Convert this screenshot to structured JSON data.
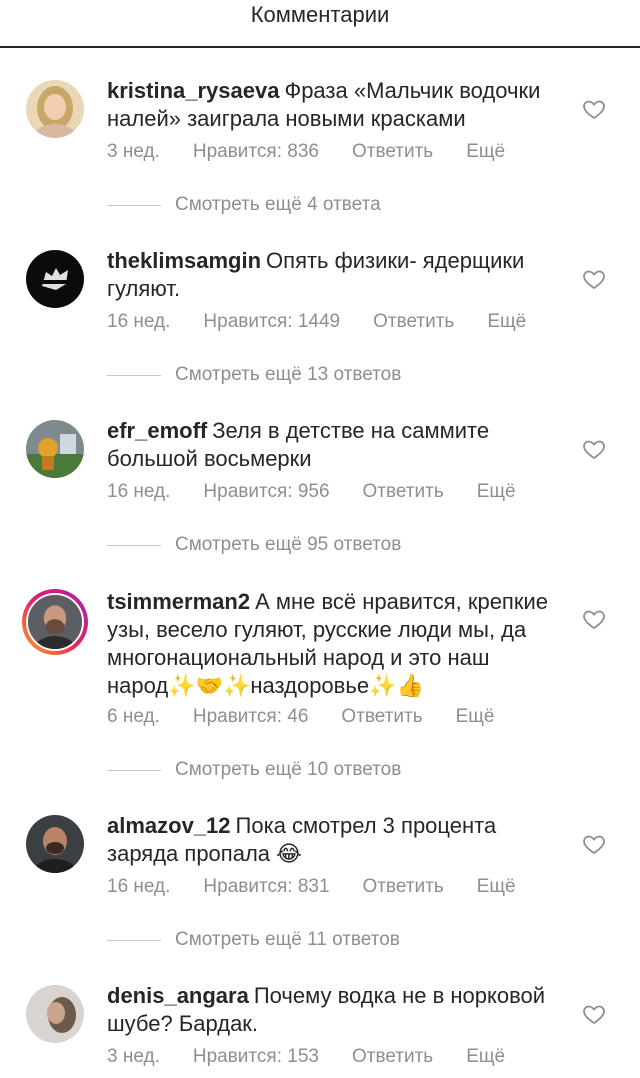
{
  "header": {
    "title": "Комментарии"
  },
  "labels": {
    "likes_prefix": "Нравится:",
    "reply": "Ответить",
    "more": "Ещё"
  },
  "comments": [
    {
      "username": "kristina_rysaeva",
      "text": "Фраза «Мальчик водочки налей» заиграла новыми красками",
      "time": "3 нед.",
      "likes": "Нравится: 836",
      "reply": "Ответить",
      "more": "Ещё",
      "view_replies": "Смотреть ещё 4 ответа"
    },
    {
      "username": "theklimsamgin",
      "text": "Опять физики- ядерщики гуляют.",
      "time": "16 нед.",
      "likes": "Нравится: 1449",
      "reply": "Ответить",
      "more": "Ещё",
      "view_replies": "Смотреть ещё 13 ответов"
    },
    {
      "username": "efr_emoff",
      "text": "Зеля в детстве на саммите большой восьмерки",
      "time": "16 нед.",
      "likes": "Нравится: 956",
      "reply": "Ответить",
      "more": "Ещё",
      "view_replies": "Смотреть ещё 95 ответов"
    },
    {
      "username": "tsimmerman2",
      "text": "А мне всё нравится, крепкие узы, весело гуляют, русские люди мы, да многонациональный народ и это наш народ✨🤝✨наздоровье✨👍",
      "time": "6 нед.",
      "likes": "Нравится: 46",
      "reply": "Ответить",
      "more": "Ещё",
      "view_replies": "Смотреть ещё 10 ответов"
    },
    {
      "username": "almazov_12",
      "text": "Пока смотрел 3 процента заряда пропала 😂",
      "time": "16 нед.",
      "likes": "Нравится: 831",
      "reply": "Ответить",
      "more": "Ещё",
      "view_replies": "Смотреть ещё 11 ответов"
    },
    {
      "username": "denis_angara",
      "text": "Почему водка не в норковой шубе? Бардак.",
      "time": "3 нед.",
      "likes": "Нравится: 153",
      "reply": "Ответить",
      "more": "Ещё"
    }
  ],
  "icons": {
    "like": "heart-outline-icon"
  }
}
